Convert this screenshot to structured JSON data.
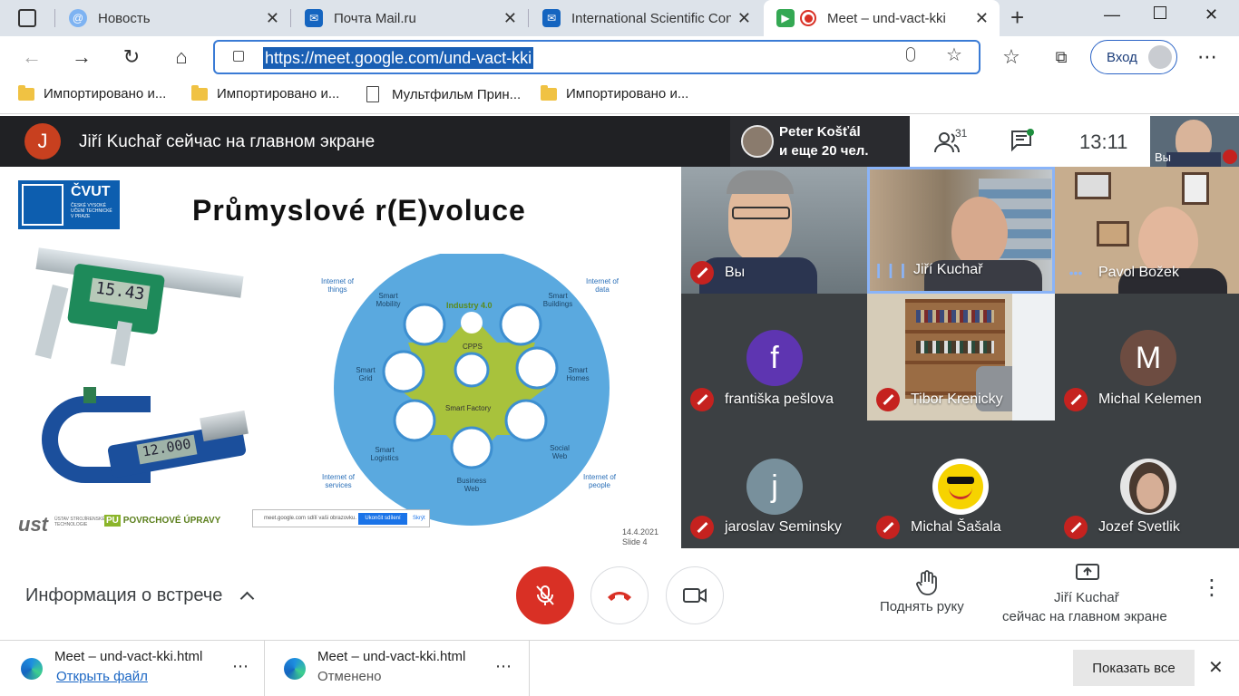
{
  "browser": {
    "tabs": [
      {
        "title": "Новость",
        "active": false
      },
      {
        "title": "Почта Mail.ru",
        "active": false
      },
      {
        "title": "International Scientific Con",
        "active": false
      },
      {
        "title": "Meet – und-vact-kki",
        "active": true
      }
    ],
    "new_tab": "+",
    "url": "https://meet.google.com/und-vact-kki",
    "login_label": "Вход",
    "bookmarks": [
      {
        "label": "Импортировано и...",
        "type": "folder"
      },
      {
        "label": "Импортировано и...",
        "type": "folder"
      },
      {
        "label": "Мультфильм Прин...",
        "type": "page"
      },
      {
        "label": "Импортировано и...",
        "type": "folder"
      }
    ]
  },
  "meet": {
    "presenter_initial": "J",
    "presenter_banner": "Jiří Kuchař сейчас на главном экране",
    "active_speaker_name": "Peter Košťál",
    "active_speaker_more": "и еще 20 чел.",
    "participants_count": "31",
    "clock": "13:11",
    "self_label": "Вы",
    "slide": {
      "title": "Průmyslové r(E)voluce",
      "logo_text": "ČVUT",
      "logo_sub": "ČESKÉ VYSOKÉ UČENÍ TECHNICKÉ V PRAZE",
      "caliper_reading": "15.43",
      "micrometer_reading": "12.000",
      "diagram_center_top": "Industry 4.0",
      "diagram_cpps": "CPPS",
      "diagram_center": "Smart Factory",
      "diagram_items": [
        "Smart Mobility",
        "Smart Buildings",
        "Smart Grid",
        "Smart Homes",
        "Smart Logistics",
        "Social Web",
        "Business Web"
      ],
      "diagram_corners": [
        "Internet of things",
        "Internet of data",
        "Internet of services",
        "Internet of people"
      ],
      "ust_logo": "ust",
      "ust_sub": "ÚSTAV STROJÍRENSKÉ TECHNOLOGIE",
      "pu_logo": "PU",
      "pu_sub": "POVRCHOVÉ ÚPRAVY",
      "share_text": "meet.google.com sdílí vaši obrazovku.",
      "share_stop": "Ukončit sdílení",
      "share_hide": "Skrýt",
      "date": "14.4.2021",
      "slide_no": "Slide 4"
    },
    "participants": [
      {
        "name": "Вы",
        "type": "video",
        "mic": "muted"
      },
      {
        "name": "Jiří Kuchař",
        "type": "video",
        "mic": "speaking"
      },
      {
        "name": "Pavol Božek",
        "type": "video",
        "mic": "active"
      },
      {
        "name": "františka pešlova",
        "type": "avatar",
        "initial": "f",
        "color": "#5e35b1",
        "mic": "muted"
      },
      {
        "name": "Tibor Krenicky",
        "type": "video",
        "mic": "muted"
      },
      {
        "name": "Michal Kelemen",
        "type": "avatar",
        "initial": "M",
        "color": "#6d4c41",
        "mic": "muted"
      },
      {
        "name": "jaroslav Seminsky",
        "type": "avatar",
        "initial": "j",
        "color": "#78909c",
        "mic": "muted"
      },
      {
        "name": "Michal Šašala",
        "type": "smiley",
        "mic": "muted"
      },
      {
        "name": "Jozef Svetlik",
        "type": "photo",
        "mic": "muted"
      }
    ],
    "controls": {
      "meeting_info": "Информация о встрече",
      "raise_hand": "Поднять руку",
      "present_line1": "Jiří Kuchař",
      "present_line2": "сейчас на главном экране"
    }
  },
  "downloads": [
    {
      "file": "Meet – und-vact-kki.html",
      "status": "Открыть файл",
      "status_is_link": true
    },
    {
      "file": "Meet – und-vact-kki.html",
      "status": "Отменено",
      "status_is_link": false
    }
  ],
  "show_all": "Показать все",
  "colors": {
    "meet_dark": "#202124",
    "mute_red": "#c5221f",
    "accent_blue": "#1a73e8"
  }
}
